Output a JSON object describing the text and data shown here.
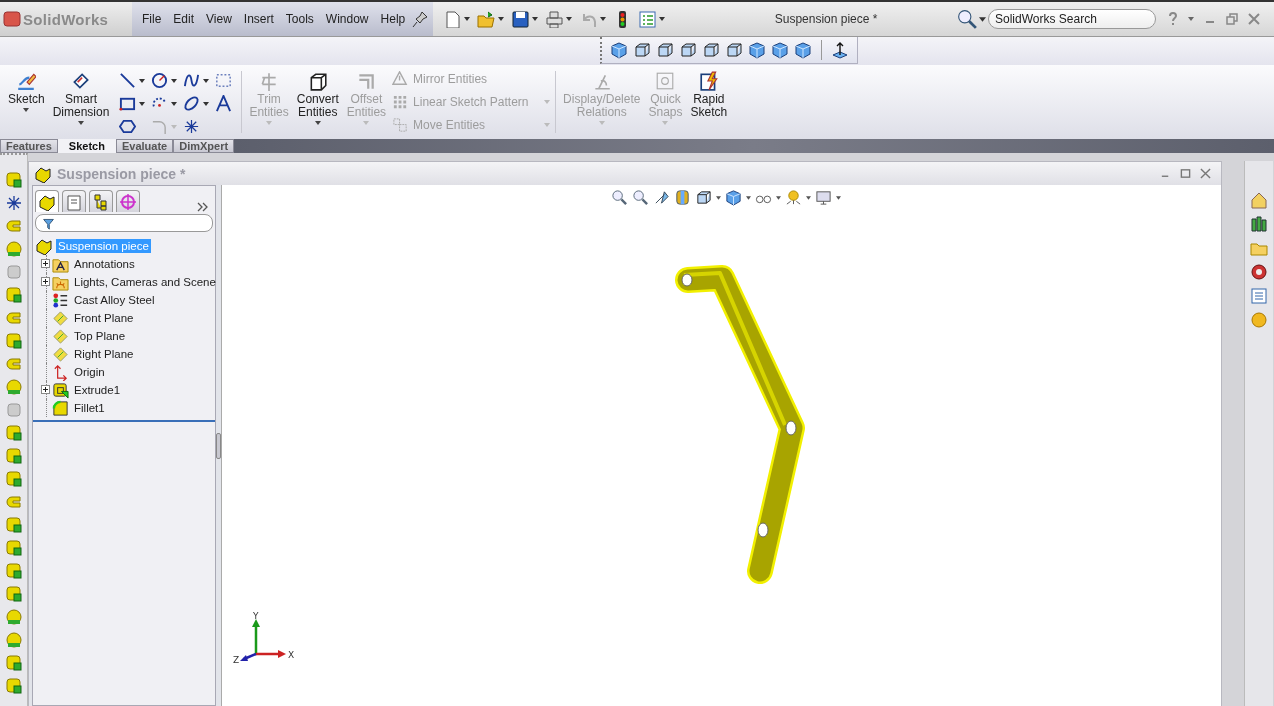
{
  "app": {
    "logo": "SolidWorks"
  },
  "menu": [
    "File",
    "Edit",
    "View",
    "Insert",
    "Tools",
    "Window",
    "Help"
  ],
  "window": {
    "title": "Suspension piece *"
  },
  "search": {
    "placeholder": "SolidWorks Search"
  },
  "ribbon": {
    "main_tools": [
      {
        "label": "Sketch",
        "disabled": false
      },
      {
        "label": "Smart Dimension",
        "disabled": false
      }
    ],
    "edit_tools": [
      {
        "label": "Trim Entities",
        "disabled": true
      },
      {
        "label": "Convert Entities",
        "disabled": false
      },
      {
        "label": "Offset Entities",
        "disabled": true
      }
    ],
    "list_tools": [
      {
        "label": "Mirror Entities",
        "disabled": true
      },
      {
        "label": "Linear Sketch Pattern",
        "disabled": true
      },
      {
        "label": "Move Entities",
        "disabled": true
      }
    ],
    "relation_tools": [
      {
        "label": "Display/Delete Relations",
        "disabled": true
      },
      {
        "label": "Quick Snaps",
        "disabled": true
      },
      {
        "label": "Rapid Sketch",
        "disabled": false
      }
    ]
  },
  "tabs": [
    {
      "label": "Features",
      "selected": false
    },
    {
      "label": "Sketch",
      "selected": true
    },
    {
      "label": "Evaluate",
      "selected": false
    },
    {
      "label": "DimXpert",
      "selected": false
    }
  ],
  "document": {
    "title": "Suspension piece *"
  },
  "panel_tabs": [
    {
      "selected": true
    },
    {
      "selected": false
    },
    {
      "selected": false
    },
    {
      "selected": false
    }
  ],
  "feature_tree": {
    "label": "Suspension piece",
    "selected": true,
    "children": [
      {
        "label": "Annotations",
        "kind": "annotations",
        "expanded": false
      },
      {
        "label": "Lights, Cameras and Scene",
        "kind": "lights",
        "expanded": false
      },
      {
        "label": "Cast Alloy Steel",
        "kind": "material"
      },
      {
        "label": "Front Plane",
        "kind": "plane"
      },
      {
        "label": "Top Plane",
        "kind": "plane"
      },
      {
        "label": "Right Plane",
        "kind": "plane"
      },
      {
        "label": "Origin",
        "kind": "origin"
      },
      {
        "label": "Extrude1",
        "kind": "extrude",
        "expanded": false
      },
      {
        "label": "Fillet1",
        "kind": "fillet"
      }
    ]
  },
  "triad": {
    "y": "Y",
    "x": "X",
    "z": "Z"
  }
}
